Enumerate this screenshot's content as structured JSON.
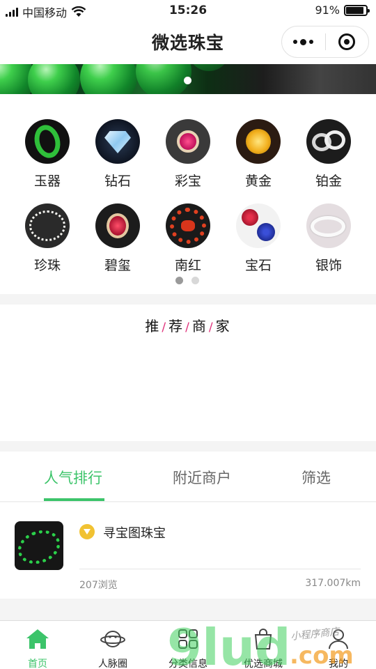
{
  "status_bar": {
    "carrier": "中国移动",
    "time": "15:26",
    "battery_text": "91%",
    "battery_level": 0.91
  },
  "nav": {
    "title": "微选珠宝"
  },
  "banner": {
    "active_slide": 1,
    "slide_count": 1
  },
  "categories": {
    "items": [
      {
        "label": "玉器",
        "icon": "jade-bangle-icon"
      },
      {
        "label": "钻石",
        "icon": "diamond-icon"
      },
      {
        "label": "彩宝",
        "icon": "gem-ring-icon"
      },
      {
        "label": "黄金",
        "icon": "gold-rose-icon"
      },
      {
        "label": "铂金",
        "icon": "platinum-ring-icon"
      },
      {
        "label": "珍珠",
        "icon": "pearl-necklace-icon"
      },
      {
        "label": "碧玺",
        "icon": "tourmaline-ring-icon"
      },
      {
        "label": "南红",
        "icon": "red-agate-icon"
      },
      {
        "label": "宝石",
        "icon": "gemstone-flower-icon"
      },
      {
        "label": "银饰",
        "icon": "silver-bangle-icon"
      }
    ],
    "page": 1,
    "page_count": 2
  },
  "merchants": {
    "title_parts": [
      "推",
      "荐",
      "商",
      "家"
    ]
  },
  "tabs": [
    {
      "label": "人气排行",
      "active": true
    },
    {
      "label": "附近商户",
      "active": false
    },
    {
      "label": "筛选",
      "active": false
    }
  ],
  "stores": [
    {
      "name": "寻宝图珠宝",
      "views": "207浏览",
      "distance": "317.007km"
    }
  ],
  "tabbar": [
    {
      "label": "首页",
      "icon": "home-icon",
      "active": true
    },
    {
      "label": "人脉圈",
      "icon": "planet-icon",
      "active": false
    },
    {
      "label": "分类信息",
      "icon": "category-icon",
      "active": false
    },
    {
      "label": "优选商城",
      "icon": "mall-bag-icon",
      "active": false
    },
    {
      "label": "我的",
      "icon": "user-icon",
      "active": false
    }
  ],
  "watermark": {
    "text_big": "9lud",
    "text_com": ".com",
    "text_small": "小程序商店"
  },
  "colors": {
    "accent": "#3cc46a",
    "slash": "#e0307a",
    "badge": "#f1c232"
  }
}
